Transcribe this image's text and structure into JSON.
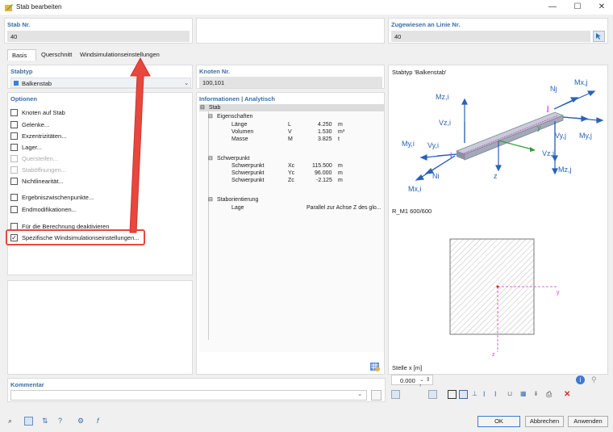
{
  "window": {
    "title": "Stab bearbeiten",
    "minimize": "—",
    "maximize": "☐",
    "close": "✕"
  },
  "header": {
    "stab_nr_label": "Stab Nr.",
    "stab_nr_value": "40",
    "linie_label": "Zugewiesen an Linie Nr.",
    "linie_value": "40"
  },
  "tabs": [
    "Basis",
    "Querschnitt",
    "Windsimulationseinstellungen"
  ],
  "stabtyp": {
    "label": "Stabtyp",
    "value": "Balkenstab"
  },
  "optionen": {
    "label": "Optionen",
    "items": [
      {
        "label": "Knoten auf Stab",
        "checked": false,
        "enabled": true
      },
      {
        "label": "Gelenke...",
        "checked": false,
        "enabled": true
      },
      {
        "label": "Exzentrizitäten...",
        "checked": false,
        "enabled": true
      },
      {
        "label": "Lager...",
        "checked": false,
        "enabled": true
      },
      {
        "label": "Quersteifen...",
        "checked": false,
        "enabled": false
      },
      {
        "label": "Staböffnungen...",
        "checked": false,
        "enabled": false
      },
      {
        "label": "Nichtlinearität...",
        "checked": false,
        "enabled": true
      },
      {
        "label": "Ergebniszwischenpunkte...",
        "checked": false,
        "enabled": true
      },
      {
        "label": "Endmodifikationen...",
        "checked": false,
        "enabled": true
      },
      {
        "label": "Für die Berechnung deaktivieren",
        "checked": false,
        "enabled": true
      },
      {
        "label": "Spezifische Windsimulationseinstellungen...",
        "checked": true,
        "enabled": true
      }
    ]
  },
  "knoten": {
    "label": "Knoten Nr.",
    "value": "100,101"
  },
  "info": {
    "label": "Informationen | Analytisch",
    "root": "Stab",
    "eigenschaften": {
      "label": "Eigenschaften",
      "rows": [
        {
          "name": "Länge",
          "sym": "L",
          "val": "4.250",
          "unit": "m"
        },
        {
          "name": "Volumen",
          "sym": "V",
          "val": "1.530",
          "unit": "m³"
        },
        {
          "name": "Masse",
          "sym": "M",
          "val": "3.825",
          "unit": "t"
        }
      ]
    },
    "schwerpunkt": {
      "label": "Schwerpunkt",
      "rows": [
        {
          "name": "Schwerpunkt",
          "sym": "Xc",
          "val": "115.500",
          "unit": "m"
        },
        {
          "name": "Schwerpunkt",
          "sym": "Yc",
          "val": "96.000",
          "unit": "m"
        },
        {
          "name": "Schwerpunkt",
          "sym": "Zc",
          "val": "-2.125",
          "unit": "m"
        }
      ]
    },
    "orient": {
      "label": "Staborientierung",
      "row_name": "Lage",
      "row_val": "Parallel zur Achse Z des glo..."
    }
  },
  "preview": {
    "stabtyp_label": "Stabtyp 'Balkenstab'",
    "section_label": "R_M1 600/600",
    "stelle_label": "Stelle x [m]",
    "stelle_value": "0.000",
    "labels": {
      "mzi": "Mz,i",
      "nj": "Nj",
      "mxj": "Mx,j",
      "vzi": "Vz,i",
      "j": "j",
      "y": "y",
      "vyj": "Vy,j",
      "myj": "My,j",
      "myi": "My,i",
      "vyi": "Vy,i",
      "i": "i",
      "vzj": "Vz,j",
      "z": "z",
      "ni": "Ni",
      "mzj": "Mz,j",
      "mxi": "Mx,i",
      "sy": "y",
      "sz": "z"
    }
  },
  "kommentar": {
    "label": "Kommentar",
    "value": ""
  },
  "buttons": {
    "ok": "OK",
    "cancel": "Abbrechen",
    "apply": "Anwenden"
  },
  "colors": {
    "accent": "#3a6ea5",
    "highlight": "#e8473d",
    "axis": "#2a62b8",
    "green": "#2f9e3a",
    "magenta": "#d43ad4"
  }
}
